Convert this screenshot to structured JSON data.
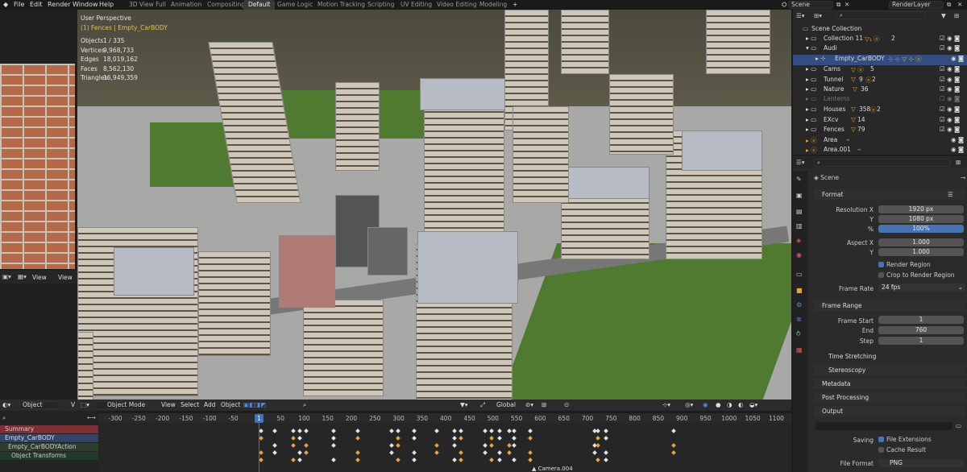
{
  "menu": [
    "File",
    "Edit",
    "Render",
    "Window",
    "Help"
  ],
  "workspaces": [
    "3D View Full",
    "Animation",
    "Compositing",
    "Default",
    "Game Logic",
    "Motion Tracking",
    "Scripting",
    "UV Editing",
    "Video Editing",
    "Modeling"
  ],
  "active_workspace": "Default",
  "add_workspace": "+",
  "scene_field": "Scene",
  "renderlayer_field": "RenderLayer",
  "viewport": {
    "title": "User Perspective",
    "subtitle": "(1) Fences | Empty_CarBODY",
    "stats": [
      {
        "label": "Objects",
        "value": "1 / 335"
      },
      {
        "label": "Vertices",
        "value": "9,968,733"
      },
      {
        "label": "Edges",
        "value": "18,019,162"
      },
      {
        "label": "Faces",
        "value": "8,562,130"
      },
      {
        "label": "Triangles",
        "value": "16,949,359"
      }
    ]
  },
  "left_panel": {
    "view1": "View",
    "view2": "View"
  },
  "vp_header": {
    "object_dropdown": "Object",
    "mode": "Object Mode",
    "view": "View",
    "select": "Select",
    "add": "Add",
    "object": "Object",
    "transform": "Global"
  },
  "timeline": {
    "ticks": [
      "-300",
      "-250",
      "-200",
      "-150",
      "-100",
      "-50",
      "1",
      "50",
      "100",
      "150",
      "200",
      "250",
      "300",
      "350",
      "400",
      "450",
      "500",
      "550",
      "600",
      "650",
      "700",
      "750",
      "800",
      "850",
      "900",
      "950",
      "1000",
      "1050",
      "1100"
    ],
    "current_frame": "1",
    "channels": [
      "Summary",
      "Empty_CarBODY",
      "Empty_CarBODYAction",
      "Object Transforms"
    ],
    "marker": "Camera.004"
  },
  "outliner": {
    "search_placeholder": "",
    "rows": [
      "Scene Collection",
      "Collection 11",
      "Audi",
      "Empty_CarBODY",
      "Cams",
      "Tunnel",
      "Nature",
      "Lanterns",
      "Houses",
      "EXcv",
      "Fences",
      "Area",
      "Area.001"
    ],
    "counts": {
      "collection11": "2",
      "cams": "5",
      "tunnel": "9",
      "tunnel2": "2",
      "nature": "36",
      "houses": "358",
      "houses2": "2",
      "excv": "14",
      "fences": "79"
    }
  },
  "properties": {
    "breadcrumb": "Scene",
    "format_section": "Format",
    "resolution_x_label": "Resolution X",
    "resolution_x": "1920 px",
    "y_label": "Y",
    "resolution_y": "1080 px",
    "percent_label": "%",
    "percent": "100%",
    "aspect_x_label": "Aspect X",
    "aspect_x": "1.000",
    "aspect_y_label": "Y",
    "aspect_y": "1.000",
    "render_region": "Render Region",
    "crop": "Crop to Render Region",
    "framerate_label": "Frame Rate",
    "framerate": "24 fps",
    "frame_range_section": "Frame Range",
    "frame_start_label": "Frame Start",
    "frame_start": "1",
    "end_label": "End",
    "frame_end": "760",
    "step_label": "Step",
    "step": "1",
    "time_stretching": "Time Stretching",
    "stereoscopy": "Stereoscopy",
    "metadata": "Metadata",
    "post_processing": "Post Processing",
    "output_section": "Output",
    "saving_label": "Saving",
    "file_extensions": "File Extensions",
    "cache_result": "Cache Result",
    "file_format_label": "File Format",
    "file_format": "PNG"
  }
}
